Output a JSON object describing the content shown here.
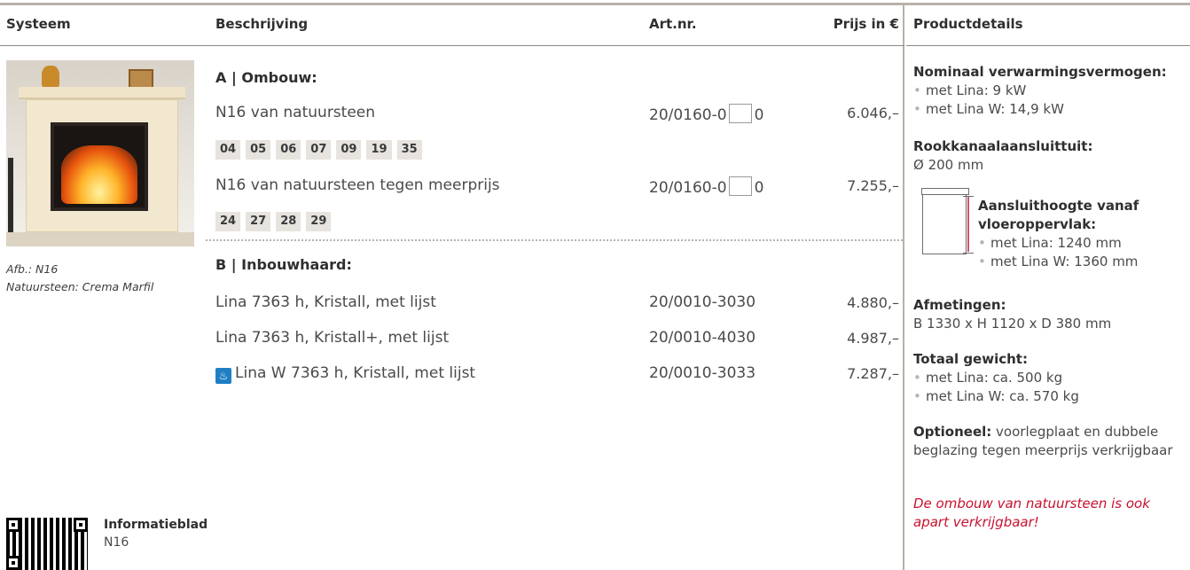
{
  "headers": {
    "systeem": "Systeem",
    "beschrijving": "Beschrijving",
    "artnr": "Art.nr.",
    "prijs": "Prijs in €",
    "productdetails": "Productdetails"
  },
  "image": {
    "caption_line1": "Afb.: N16",
    "caption_line2": "Natuursteen: Crema Marfil"
  },
  "section_a": {
    "title": "A | Ombouw:",
    "rows": [
      {
        "desc": "N16 van natuursteen",
        "art_prefix": "20/0160-0",
        "art_suffix": "0",
        "price": "6.046,–"
      },
      {
        "desc": "N16 van natuursteen tegen meerprijs",
        "art_prefix": "20/0160-0",
        "art_suffix": "0",
        "price": "7.255,–"
      }
    ],
    "chips_1": [
      "04",
      "05",
      "06",
      "07",
      "09",
      "19",
      "35"
    ],
    "chips_2": [
      "24",
      "27",
      "28",
      "29"
    ]
  },
  "section_b": {
    "title": "B | Inbouwhaard:",
    "rows": [
      {
        "desc": "Lina 7363 h, Kristall, met lijst",
        "art": "20/0010-3030",
        "price": "4.880,–"
      },
      {
        "desc": "Lina 7363 h, Kristall+, met lijst",
        "art": "20/0010-4030",
        "price": "4.987,–"
      },
      {
        "desc": "Lina W 7363 h, Kristall, met lijst",
        "art": "20/0010-3033",
        "price": "7.287,–",
        "icon": "water-heating-icon"
      }
    ]
  },
  "info": {
    "title": "Informatieblad",
    "sub": "N16"
  },
  "details": {
    "heating_label": "Nominaal verwarmingsvermogen:",
    "heating_1": "met Lina: 9 kW",
    "heating_2": "met Lina W: 14,9 kW",
    "flue_label": "Rookkanaalaansluittuit:",
    "flue_value": "Ø 200 mm",
    "height_label_1": "Aansluithoogte vanaf",
    "height_label_2": "vloeroppervlak:",
    "height_1": "met Lina: 1240 mm",
    "height_2": "met Lina W: 1360 mm",
    "dim_label": "Afmetingen:",
    "dim_value": "B 1330 x H 1120 x D 380 mm",
    "weight_label": "Totaal gewicht:",
    "weight_1": "met Lina: ca. 500 kg",
    "weight_2": "met Lina W: ca. 570 kg",
    "optional_label": "Optioneel:",
    "optional_text": " voorlegplaat en dubbele beglazing tegen meerprijs verkrijgbaar",
    "note": "De ombouw van natuursteen is ook apart verkrijgbaar!"
  },
  "colors": {
    "accent_red": "#c8102e",
    "chip_bg": "#e7e3de",
    "rule": "#b9b2aa"
  }
}
